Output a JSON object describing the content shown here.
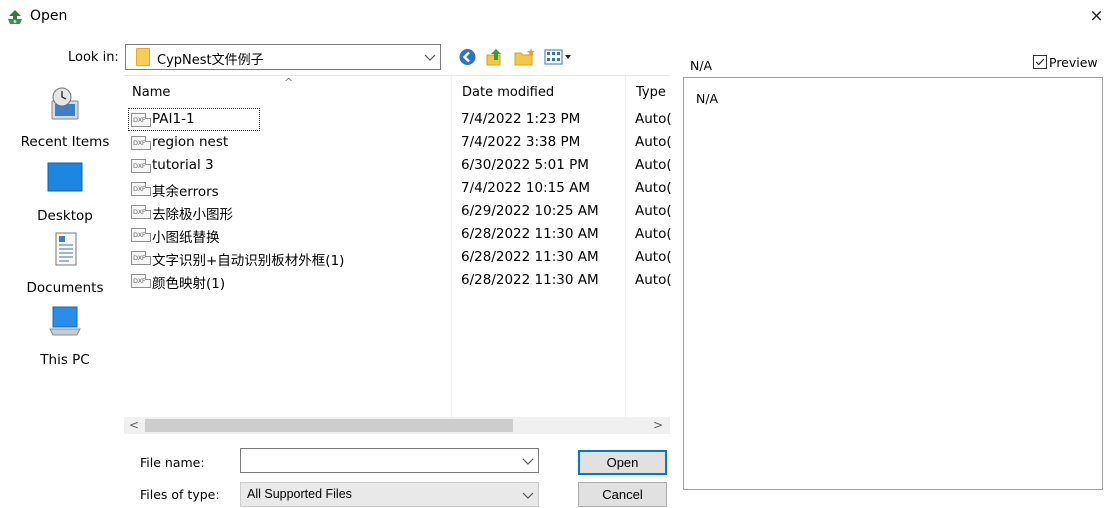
{
  "window": {
    "title": "Open",
    "close_glyph": "×"
  },
  "lookin": {
    "label": "Look in:",
    "value": "CypNest文件例子",
    "folder_icon": "folder-icon"
  },
  "toolbar": {
    "icons": [
      "back-icon",
      "up-folder-icon",
      "new-folder-icon",
      "views-menu-icon"
    ]
  },
  "places": [
    {
      "label": "Recent Items",
      "icon": "recent-items-icon"
    },
    {
      "label": "Desktop",
      "icon": "desktop-icon"
    },
    {
      "label": "Documents",
      "icon": "documents-icon"
    },
    {
      "label": "This PC",
      "icon": "this-pc-icon"
    }
  ],
  "columns": {
    "name": "Name",
    "date": "Date modified",
    "type": "Type",
    "sort_indicator": "^"
  },
  "files": [
    {
      "icon_text": "DXF",
      "name": "PAI1-1",
      "date": "7/4/2022 1:23 PM",
      "type": "Auto(",
      "selected": true
    },
    {
      "icon_text": "DXF",
      "name": "region nest",
      "date": "7/4/2022 3:38 PM",
      "type": "Auto("
    },
    {
      "icon_text": "DXF",
      "name": "tutorial 3",
      "date": "6/30/2022 5:01 PM",
      "type": "Auto("
    },
    {
      "icon_text": "DXF",
      "name": "其余errors",
      "date": "7/4/2022 10:15 AM",
      "type": "Auto("
    },
    {
      "icon_text": "DXF",
      "name": "去除极小图形",
      "date": "6/29/2022 10:25 AM",
      "type": "Auto("
    },
    {
      "icon_text": "DXF",
      "name": "小图纸替换",
      "date": "6/28/2022 11:30 AM",
      "type": "Auto("
    },
    {
      "icon_text": "DXF",
      "name": "文字识别+自动识别板材外框(1)",
      "date": "6/28/2022 11:30 AM",
      "type": "Auto("
    },
    {
      "icon_text": "DXF",
      "name": "颜色映射(1)",
      "date": "6/28/2022 11:30 AM",
      "type": "Auto("
    }
  ],
  "scroll": {
    "left_glyph": "<",
    "right_glyph": ">"
  },
  "filename": {
    "label": "File name:",
    "value": "",
    "placeholder": ""
  },
  "filetype": {
    "label": "Files of type:",
    "value": "All Supported Files"
  },
  "buttons": {
    "open": "Open",
    "cancel": "Cancel"
  },
  "preview": {
    "top_label": "N/A",
    "checkbox_label": "Preview",
    "checked": true,
    "pane_text": "N/A"
  },
  "colors": {
    "accent": "#0078d7",
    "folder": "#f8cc5a"
  }
}
